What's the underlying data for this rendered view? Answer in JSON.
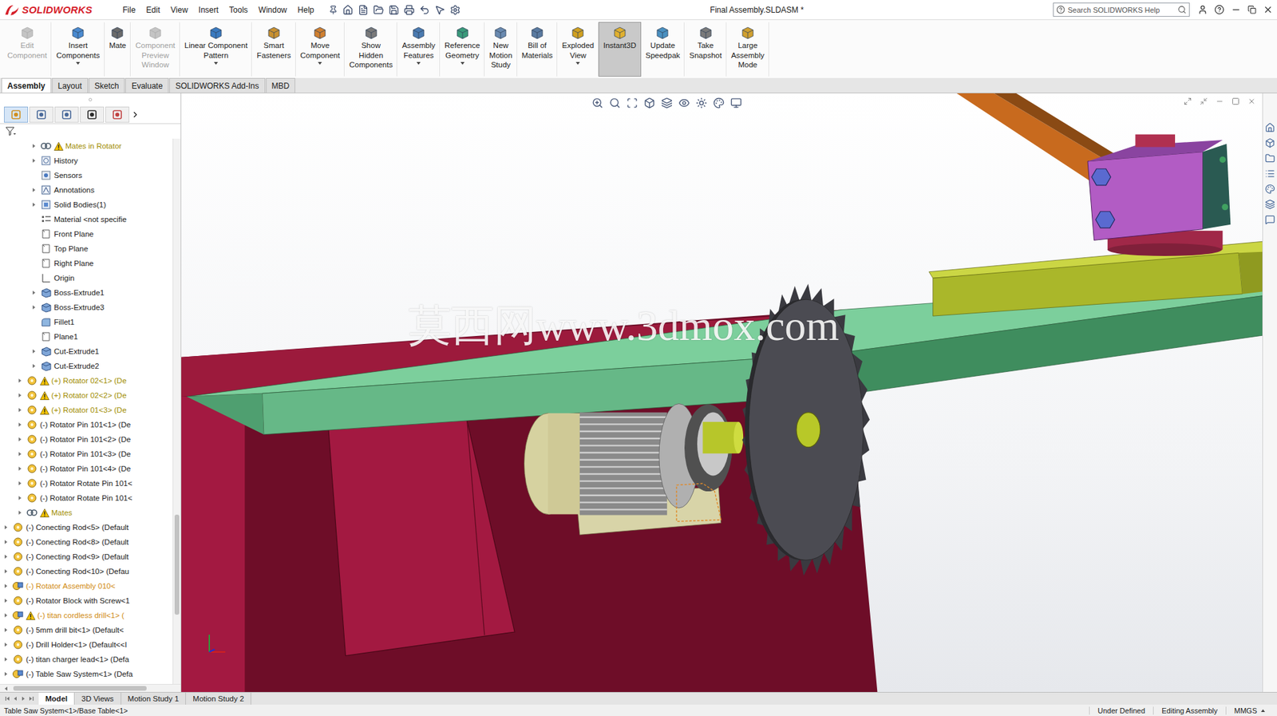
{
  "window": {
    "title": "Final Assembly.SLDASM *"
  },
  "logo": "SOLIDWORKS",
  "menu": [
    "File",
    "Edit",
    "View",
    "Insert",
    "Tools",
    "Window",
    "Help"
  ],
  "search": {
    "placeholder": "Search SOLIDWORKS Help"
  },
  "ribbon": [
    {
      "lines": [
        "Edit",
        "Component"
      ],
      "disabled": true,
      "dropdown": false,
      "selected": false
    },
    {
      "lines": [
        "Insert",
        "Components"
      ],
      "disabled": false,
      "dropdown": true,
      "selected": false
    },
    {
      "lines": [
        "Mate"
      ],
      "disabled": false,
      "dropdown": false,
      "selected": false
    },
    {
      "lines": [
        "Component",
        "Preview",
        "Window"
      ],
      "disabled": true,
      "dropdown": false,
      "selected": false
    },
    {
      "lines": [
        "Linear Component",
        "Pattern"
      ],
      "disabled": false,
      "dropdown": true,
      "selected": false
    },
    {
      "lines": [
        "Smart",
        "Fasteners"
      ],
      "disabled": false,
      "dropdown": false,
      "selected": false
    },
    {
      "lines": [
        "Move",
        "Component"
      ],
      "disabled": false,
      "dropdown": true,
      "selected": false
    },
    {
      "lines": [
        "Show",
        "Hidden",
        "Components"
      ],
      "disabled": false,
      "dropdown": false,
      "selected": false
    },
    {
      "lines": [
        "Assembly",
        "Features"
      ],
      "disabled": false,
      "dropdown": true,
      "selected": false
    },
    {
      "lines": [
        "Reference",
        "Geometry"
      ],
      "disabled": false,
      "dropdown": true,
      "selected": false
    },
    {
      "lines": [
        "New",
        "Motion",
        "Study"
      ],
      "disabled": false,
      "dropdown": false,
      "selected": false
    },
    {
      "lines": [
        "Bill of",
        "Materials"
      ],
      "disabled": false,
      "dropdown": false,
      "selected": false
    },
    {
      "lines": [
        "Exploded",
        "View"
      ],
      "disabled": false,
      "dropdown": true,
      "selected": false
    },
    {
      "lines": [
        "Instant3D"
      ],
      "disabled": false,
      "dropdown": false,
      "selected": true
    },
    {
      "lines": [
        "Update",
        "Speedpak"
      ],
      "disabled": false,
      "dropdown": false,
      "selected": false
    },
    {
      "lines": [
        "Take",
        "Snapshot"
      ],
      "disabled": false,
      "dropdown": false,
      "selected": false
    },
    {
      "lines": [
        "Large",
        "Assembly",
        "Mode"
      ],
      "disabled": false,
      "dropdown": false,
      "selected": false
    }
  ],
  "ribbon_tabs": [
    {
      "label": "Assembly",
      "selected": true
    },
    {
      "label": "Layout",
      "selected": false
    },
    {
      "label": "Sketch",
      "selected": false
    },
    {
      "label": "Evaluate",
      "selected": false
    },
    {
      "label": "SOLIDWORKS Add-Ins",
      "selected": false
    },
    {
      "label": "MBD",
      "selected": false
    }
  ],
  "panel_tabs": [
    {
      "selected": true
    },
    {
      "selected": false
    },
    {
      "selected": false
    },
    {
      "selected": false
    },
    {
      "selected": false
    }
  ],
  "tree": [
    {
      "label": "Mates in Rotator",
      "level": 2,
      "kind": "mates",
      "expandable": true,
      "expanded": false,
      "warning": true,
      "color": "#a08c00"
    },
    {
      "label": "History",
      "level": 2,
      "kind": "history",
      "expandable": true,
      "expanded": false,
      "warning": false,
      "color": "#1a1a1a"
    },
    {
      "label": "Sensors",
      "level": 2,
      "kind": "sensors",
      "expandable": false,
      "expanded": false,
      "warning": false,
      "color": "#1a1a1a"
    },
    {
      "label": "Annotations",
      "level": 2,
      "kind": "annotations",
      "expandable": true,
      "expanded": false,
      "warning": false,
      "color": "#1a1a1a"
    },
    {
      "label": "Solid Bodies(1)",
      "level": 2,
      "kind": "bodies",
      "expandable": true,
      "expanded": false,
      "warning": false,
      "color": "#1a1a1a"
    },
    {
      "label": "Material <not specifie",
      "level": 2,
      "kind": "material",
      "expandable": false,
      "expanded": false,
      "warning": false,
      "color": "#1a1a1a"
    },
    {
      "label": "Front Plane",
      "level": 2,
      "kind": "plane",
      "expandable": false,
      "expanded": false,
      "warning": false,
      "color": "#1a1a1a"
    },
    {
      "label": "Top Plane",
      "level": 2,
      "kind": "plane",
      "expandable": false,
      "expanded": false,
      "warning": false,
      "color": "#1a1a1a"
    },
    {
      "label": "Right Plane",
      "level": 2,
      "kind": "plane",
      "expandable": false,
      "expanded": false,
      "warning": false,
      "color": "#1a1a1a"
    },
    {
      "label": "Origin",
      "level": 2,
      "kind": "origin",
      "expandable": false,
      "expanded": false,
      "warning": false,
      "color": "#1a1a1a"
    },
    {
      "label": "Boss-Extrude1",
      "level": 2,
      "kind": "feature",
      "expandable": true,
      "expanded": false,
      "warning": false,
      "color": "#1a1a1a"
    },
    {
      "label": "Boss-Extrude3",
      "level": 2,
      "kind": "feature",
      "expandable": true,
      "expanded": false,
      "warning": false,
      "color": "#1a1a1a"
    },
    {
      "label": "Fillet1",
      "level": 2,
      "kind": "fillet",
      "expandable": false,
      "expanded": false,
      "warning": false,
      "color": "#1a1a1a"
    },
    {
      "label": "Plane1",
      "level": 2,
      "kind": "plane",
      "expandable": false,
      "expanded": false,
      "warning": false,
      "color": "#1a1a1a"
    },
    {
      "label": "Cut-Extrude1",
      "level": 2,
      "kind": "feature",
      "expandable": true,
      "expanded": false,
      "warning": false,
      "color": "#1a1a1a"
    },
    {
      "label": "Cut-Extrude2",
      "level": 2,
      "kind": "feature",
      "expandable": true,
      "expanded": false,
      "warning": false,
      "color": "#1a1a1a"
    },
    {
      "label": "(+) Rotator 02<1> (De",
      "level": 1,
      "kind": "part",
      "expandable": true,
      "expanded": false,
      "warning": true,
      "color": "#a08c00"
    },
    {
      "label": "(+) Rotator 02<2> (De",
      "level": 1,
      "kind": "part",
      "expandable": true,
      "expanded": false,
      "warning": true,
      "color": "#a08c00"
    },
    {
      "label": "(+) Rotator 01<3> (De",
      "level": 1,
      "kind": "part",
      "expandable": true,
      "expanded": false,
      "warning": true,
      "color": "#a08c00"
    },
    {
      "label": "(-) Rotator Pin 101<1> (De",
      "level": 1,
      "kind": "part",
      "expandable": true,
      "expanded": false,
      "warning": false,
      "color": "#1a1a1a"
    },
    {
      "label": "(-) Rotator Pin 101<2> (De",
      "level": 1,
      "kind": "part",
      "expandable": true,
      "expanded": false,
      "warning": false,
      "color": "#1a1a1a"
    },
    {
      "label": "(-) Rotator Pin 101<3> (De",
      "level": 1,
      "kind": "part",
      "expandable": true,
      "expanded": false,
      "warning": false,
      "color": "#1a1a1a"
    },
    {
      "label": "(-) Rotator Pin 101<4> (De",
      "level": 1,
      "kind": "part",
      "expandable": true,
      "expanded": false,
      "warning": false,
      "color": "#1a1a1a"
    },
    {
      "label": "(-) Rotator Rotate Pin 101<",
      "level": 1,
      "kind": "part",
      "expandable": true,
      "expanded": false,
      "warning": false,
      "color": "#1a1a1a"
    },
    {
      "label": "(-) Rotator Rotate Pin 101<",
      "level": 1,
      "kind": "part",
      "expandable": true,
      "expanded": false,
      "warning": false,
      "color": "#1a1a1a"
    },
    {
      "label": "Mates",
      "level": 1,
      "kind": "mates",
      "expandable": true,
      "expanded": false,
      "warning": true,
      "color": "#a08c00"
    },
    {
      "label": "(-) Conecting Rod<5> (Default",
      "level": 0,
      "kind": "part",
      "expandable": true,
      "expanded": false,
      "warning": false,
      "color": "#1a1a1a"
    },
    {
      "label": "(-) Conecting Rod<8> (Default",
      "level": 0,
      "kind": "part",
      "expandable": true,
      "expanded": false,
      "warning": false,
      "color": "#1a1a1a"
    },
    {
      "label": "(-) Conecting Rod<9> (Default",
      "level": 0,
      "kind": "part",
      "expandable": true,
      "expanded": false,
      "warning": false,
      "color": "#1a1a1a"
    },
    {
      "label": "(-) Conecting Rod<10> (Defau",
      "level": 0,
      "kind": "part",
      "expandable": true,
      "expanded": false,
      "warning": false,
      "color": "#1a1a1a"
    },
    {
      "label": "(-) Rotator Assembly 010<",
      "level": 0,
      "kind": "assembly",
      "expandable": true,
      "expanded": false,
      "warning": false,
      "color": "#d08a10"
    },
    {
      "label": "(-) Rotator Block with Screw<1",
      "level": 0,
      "kind": "part",
      "expandable": true,
      "expanded": false,
      "warning": false,
      "color": "#1a1a1a"
    },
    {
      "label": "(-) titan cordless drill<1> (",
      "level": 0,
      "kind": "assembly",
      "expandable": true,
      "expanded": false,
      "warning": true,
      "color": "#d08a10"
    },
    {
      "label": "(-) 5mm drill bit<1> (Default<",
      "level": 0,
      "kind": "part",
      "expandable": true,
      "expanded": false,
      "warning": false,
      "color": "#1a1a1a"
    },
    {
      "label": "(-) Drill Holder<1> (Default<<I",
      "level": 0,
      "kind": "part",
      "expandable": true,
      "expanded": false,
      "warning": false,
      "color": "#1a1a1a"
    },
    {
      "label": "(-) titan charger lead<1> (Defa",
      "level": 0,
      "kind": "part",
      "expandable": true,
      "expanded": false,
      "warning": false,
      "color": "#1a1a1a"
    },
    {
      "label": "(-) Table Saw System<1> (Defa",
      "level": 0,
      "kind": "assembly",
      "expandable": true,
      "expanded": false,
      "warning": false,
      "color": "#1a1a1a"
    }
  ],
  "tree_scrollbar": {
    "level": 0.86
  },
  "watermark": "莫西网www.3dmox.com",
  "bottom_tabs": [
    {
      "label": "Model",
      "selected": true
    },
    {
      "label": "3D Views",
      "selected": false
    },
    {
      "label": "Motion Study 1",
      "selected": false
    },
    {
      "label": "Motion Study 2",
      "selected": false
    }
  ],
  "status_bar": {
    "path": "Table Saw System<1>/Base Table<1>",
    "items": [
      "Under Defined",
      "Editing Assembly",
      "MMGS"
    ]
  }
}
